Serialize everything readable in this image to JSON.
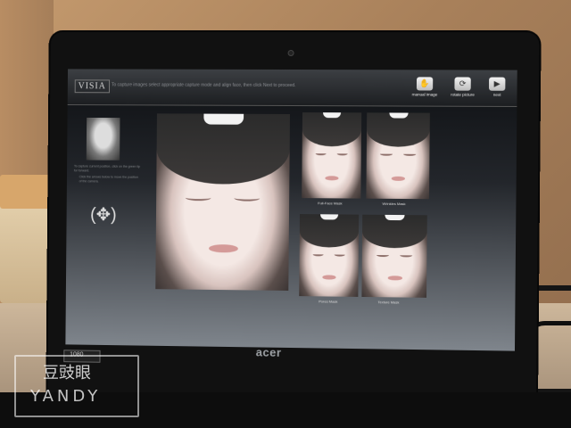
{
  "app": {
    "logo": "VISIA",
    "instruction": "To capture images select appropriate capture mode and align face, then click Next to proceed."
  },
  "toolbar": {
    "items": [
      {
        "label": "manual image",
        "icon": "hand-icon"
      },
      {
        "label": "rotate picture",
        "icon": "rotate-icon"
      },
      {
        "label": "next",
        "icon": "play-icon"
      }
    ]
  },
  "left_panel": {
    "caption_1": "To capture current position, click on the green tip for forward.",
    "caption_2": "Click the arrows below to move the position of the camera."
  },
  "masks": [
    {
      "label": "Full-Face Mask"
    },
    {
      "label": "Wrinkles Mask"
    },
    {
      "label": "Pores Mask"
    },
    {
      "label": "Texture Mask"
    }
  ],
  "laptop": {
    "brand": "acer",
    "badge": "1080"
  },
  "watermark": {
    "chinese": "豆豉眼",
    "latin": "YANDY"
  }
}
